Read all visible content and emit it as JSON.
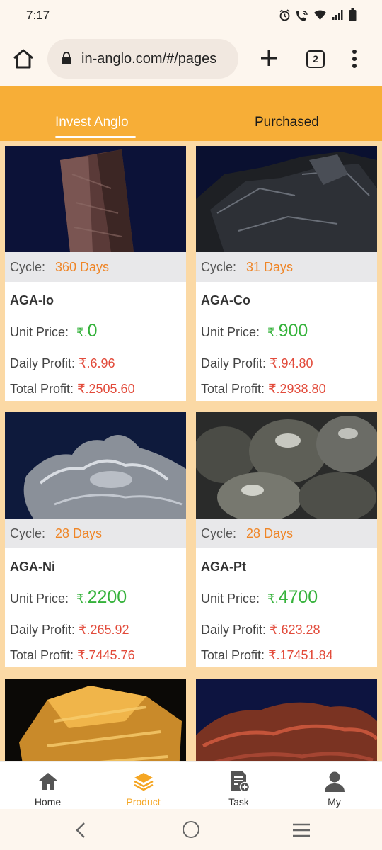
{
  "status_bar": {
    "time": "7:17",
    "icons": [
      "alarm-icon",
      "wifi-call-icon",
      "wifi-icon",
      "signal-icon",
      "battery-icon"
    ]
  },
  "browser": {
    "url": "in-anglo.com/#/pages",
    "tab_count": "2"
  },
  "header": {
    "tabs": [
      {
        "label": "Invest Anglo",
        "active": true
      },
      {
        "label": "Purchased",
        "active": false
      }
    ]
  },
  "labels": {
    "cycle": "Cycle:",
    "unit_price": "Unit Price:",
    "daily_profit": "Daily Profit:",
    "total_profit": "Total Profit:",
    "currency": "₹."
  },
  "products": [
    {
      "name": "AGA-Io",
      "cycle": "360 Days",
      "unit_price": "0",
      "daily_profit": "₹.6.96",
      "total_profit": "₹.2505.60",
      "image": "mineral-dark-red-crystal"
    },
    {
      "name": "AGA-Co",
      "cycle": "31 Days",
      "unit_price": "900",
      "daily_profit": "₹.94.80",
      "total_profit": "₹.2938.80",
      "image": "mineral-black-rock"
    },
    {
      "name": "AGA-Ni",
      "cycle": "28 Days",
      "unit_price": "2200",
      "daily_profit": "₹.265.92",
      "total_profit": "₹.7445.76",
      "image": "mineral-silver-nugget"
    },
    {
      "name": "AGA-Pt",
      "cycle": "28 Days",
      "unit_price": "4700",
      "daily_profit": "₹.623.28",
      "total_profit": "₹.17451.84",
      "image": "mineral-grey-crystals"
    },
    {
      "name": "",
      "cycle": "",
      "unit_price": "",
      "daily_profit": "",
      "total_profit": "",
      "image": "mineral-orange-crystal"
    },
    {
      "name": "",
      "cycle": "",
      "unit_price": "",
      "daily_profit": "",
      "total_profit": "",
      "image": "mineral-red-rock"
    }
  ],
  "bottom_nav": [
    {
      "label": "Home",
      "icon": "home-icon",
      "active": false
    },
    {
      "label": "Product",
      "icon": "layers-icon",
      "active": true
    },
    {
      "label": "Task",
      "icon": "task-icon",
      "active": false
    },
    {
      "label": "My",
      "icon": "user-icon",
      "active": false
    }
  ],
  "colors": {
    "header_orange": "#f7ae37",
    "grid_bg": "#fbd9a5",
    "cycle_value": "#ef8526",
    "price_green": "#35b23b",
    "profit_red": "#e24b3b",
    "nav_active": "#f5a623"
  }
}
